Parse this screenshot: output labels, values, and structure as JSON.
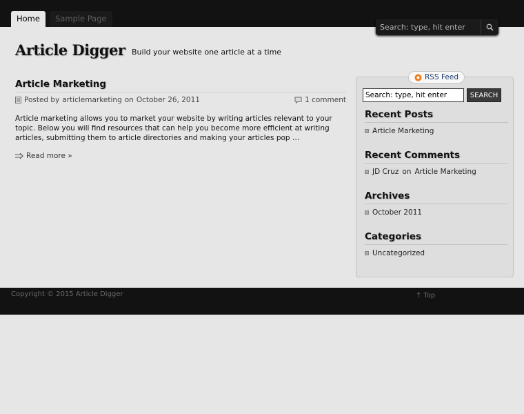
{
  "nav": {
    "items": [
      {
        "label": "Home"
      },
      {
        "label": "Sample Page"
      }
    ]
  },
  "top_search": {
    "placeholder": "Search: type, hit enter"
  },
  "site": {
    "title": "Article Digger",
    "tagline": "Build your website one article at a time"
  },
  "post": {
    "title": "Article Marketing",
    "meta_posted_by": "Posted by",
    "author": "articlemarketing",
    "meta_on": "on",
    "date": "October 26, 2011",
    "comments": "1 comment",
    "excerpt": "Article marketing allows you to market your website by writing articles relevant to your topic. Below you will find resources that can help you become more efficient at writing articles, submitting them to article directories and making your articles pop …",
    "read_more": "Read more »"
  },
  "sidebar": {
    "rss_label": "RSS Feed",
    "search": {
      "placeholder": "Search: type, hit enter",
      "button": "SEARCH"
    },
    "recent_posts": {
      "title": "Recent Posts",
      "items": [
        "Article Marketing"
      ]
    },
    "recent_comments": {
      "title": "Recent Comments",
      "author": "JD Cruz",
      "on": "on",
      "post": "Article Marketing"
    },
    "archives": {
      "title": "Archives",
      "items": [
        "October 2011"
      ]
    },
    "categories": {
      "title": "Categories",
      "items": [
        "Uncategorized"
      ]
    }
  },
  "footer": {
    "copyright": "Copyright © 2015 Article Digger",
    "top_arrow": "↑",
    "top_label": "Top"
  }
}
